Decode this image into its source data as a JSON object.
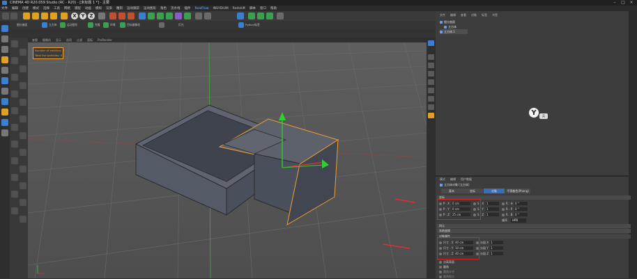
{
  "window": {
    "title": "CINEMA 4D R20.059 Studio (RC - R20) - [未标题 1 *] - 主要"
  },
  "menubar": {
    "items": [
      "文件",
      "编辑",
      "创建",
      "模式",
      "选择",
      "工具",
      "网格",
      "捕捉",
      "动画",
      "模拟",
      "渲染",
      "雕刻",
      "运动跟踪",
      "运动图形",
      "角色",
      "流水线",
      "插件",
      "RealFlow",
      "INSYDIUM",
      "Redshift",
      "脚本",
      "窗口",
      "帮助"
    ],
    "accent_index": 17
  },
  "toolbar2": {
    "labels": [
      "细分曲面",
      "立方体",
      "运动图形",
      "克隆",
      "环境",
      "目标摄像机",
      "灯光",
      "Python标签"
    ]
  },
  "viewport": {
    "menus": [
      "查看",
      "摄像机",
      "显示",
      "选项",
      "过滤",
      "面板",
      "ProRender"
    ]
  },
  "hud": {
    "line1": "Number of emitters: 0",
    "line2": "Total live particles: 0"
  },
  "object_manager": {
    "tabs": [
      "文件",
      "编辑",
      "查看",
      "对象",
      "标签",
      "书签"
    ],
    "objects": [
      "细分曲面",
      "立方体",
      "立方体.1"
    ]
  },
  "badge": {
    "glyph": "Y",
    "tag": "英"
  },
  "attributes": {
    "tabs_top": [
      "模式",
      "编辑",
      "用户数据"
    ],
    "object_title": "立方体对象 [立方体]",
    "tabs": [
      "基本",
      "坐标",
      "对象",
      "平滑着色(Phong)"
    ],
    "active_tab": 2,
    "coord_section": "坐标",
    "coords": [
      {
        "axis": "P . X",
        "value": "0 cm",
        "s_label": "S . X",
        "s_value": "1",
        "r_label": "R . H",
        "r_value": "0 °"
      },
      {
        "axis": "P . Y",
        "value": "0 cm",
        "s_label": "S . Y",
        "s_value": "1",
        "r_label": "R . P",
        "r_value": "0 °"
      },
      {
        "axis": "P . Z",
        "value": "25 cm",
        "s_label": "S . Z",
        "s_value": "1",
        "r_label": "R . B",
        "r_value": "0 °"
      }
    ],
    "order_label": "顺序",
    "order_value": "HPB",
    "sections": [
      "四元",
      "冻结变换"
    ],
    "object_section": "对象属性",
    "sizes": [
      {
        "label": "尺寸 . X",
        "value": "40 cm",
        "seg_label": "分段 X",
        "seg_value": "1"
      },
      {
        "label": "尺寸 . Y",
        "value": "10 cm",
        "seg_label": "分段 Y",
        "seg_value": "1"
      },
      {
        "label": "尺寸 . Z",
        "value": "40 cm",
        "seg_label": "分段 Z",
        "seg_value": "1"
      }
    ],
    "extra": [
      "分离表面",
      "圆角",
      "圆角半径",
      "圆角细分"
    ]
  },
  "colors": {
    "highlight": "#e02020",
    "hud": "#f0a030",
    "accent": "#3a7fd0"
  }
}
